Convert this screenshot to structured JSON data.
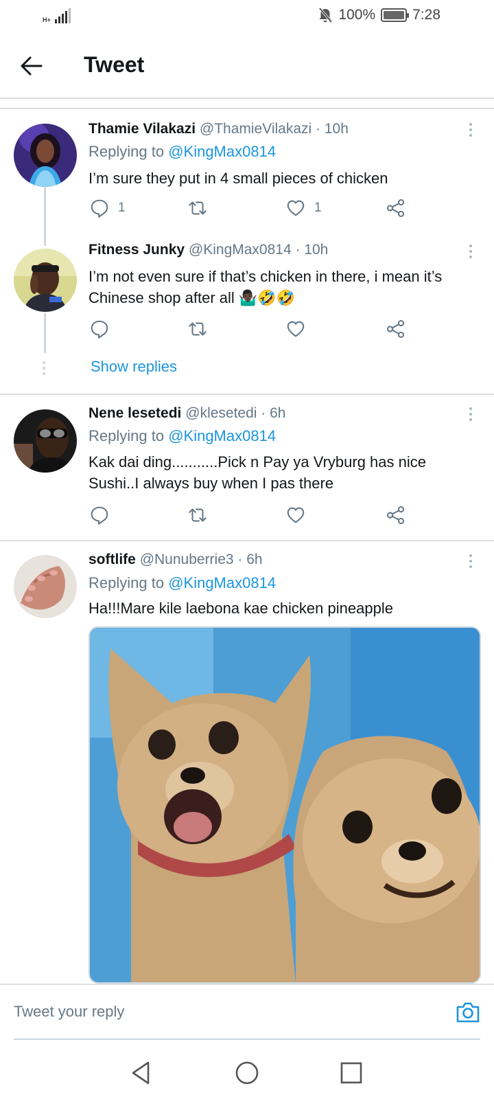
{
  "status_bar": {
    "network": "H+",
    "battery_pct": "100%",
    "battery_level": 1.0,
    "time": "7:28"
  },
  "header": {
    "title": "Tweet"
  },
  "tweets": [
    {
      "name": "Thamie Vilakazi",
      "handle": "@ThamieVilakazi",
      "time": "· 10h",
      "replying_prefix": "Replying to ",
      "replying_to": "@KingMax0814",
      "text": "I’m sure they put in 4 small pieces of chicken",
      "reply_count": "1",
      "like_count": "1"
    },
    {
      "name": "Fitness Junky",
      "handle": "@KingMax0814",
      "time": "· 10h",
      "text": "I’m not even sure if that’s chicken in there, i mean it’s Chinese shop after all 🤷🏿‍♂️🤣🤣",
      "show_replies": "Show replies"
    },
    {
      "name": "Nene lesetedi",
      "handle": "@klesetedi",
      "time": "· 6h",
      "replying_prefix": "Replying to ",
      "replying_to": "@KingMax0814",
      "text": "Kak dai ding...........Pick n Pay ya Vryburg has nice Sushi..I always buy when I pas there"
    },
    {
      "name": "softlife",
      "handle": "@Nunuberrie3",
      "time": "· 6h",
      "replying_prefix": "Replying to ",
      "replying_to": "@KingMax0814",
      "text": "Ha!!!Mare kile laebona kae chicken pineapple"
    }
  ],
  "reply_bar": {
    "placeholder": "Tweet your reply"
  },
  "icons": {
    "back": "arrow-left-icon",
    "reply": "speech-bubble-icon",
    "retweet": "retweet-icon",
    "like": "heart-icon",
    "share": "share-icon",
    "more": "more-vertical-icon",
    "camera": "camera-icon",
    "nav_back": "triangle-back-icon",
    "nav_home": "circle-home-icon",
    "nav_recents": "square-recents-icon"
  },
  "colors": {
    "link": "#1b95e0",
    "secondary_text": "#657786",
    "divider": "#dcdfe3"
  }
}
